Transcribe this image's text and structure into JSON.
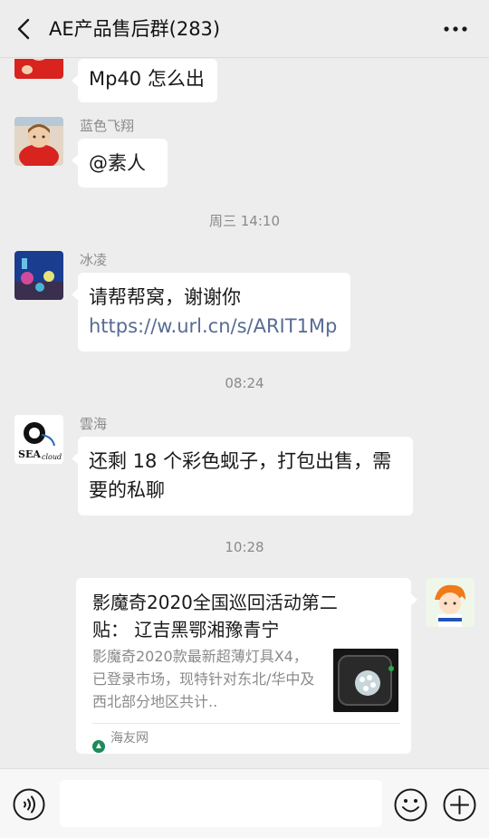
{
  "header": {
    "title": "AE产品售后群(283)",
    "back_icon": "chevron-left-icon",
    "more_icon": "more-dots-icon"
  },
  "messages": [
    {
      "sender": "",
      "text": "Mp40 怎么出"
    },
    {
      "sender": "蓝色飞翔",
      "text": "@素人"
    },
    {
      "timestamp": "周三 14:10"
    },
    {
      "sender": "冰凌",
      "text": "请帮帮窝，谢谢你",
      "link": "https://w.url.cn/s/ARIT1Mp"
    },
    {
      "timestamp": "08:24"
    },
    {
      "sender": "雲海",
      "text": "还剩 18 个彩色蚬子，打包出售，需要的私聊",
      "avatar_text": "sea_cloud"
    },
    {
      "timestamp": "10:28"
    },
    {
      "card": {
        "title": "影魔奇2020全国巡回活动第二贴： 辽吉黑鄂湘豫青宁",
        "desc": "影魔奇2020款最新超薄灯具X4，已登录市场，现特针对东北/华中及西北部分地区共计..",
        "source": "海友网"
      }
    }
  ],
  "composer": {
    "input_value": "",
    "voice_icon": "voice-icon",
    "emoji_icon": "emoji-icon",
    "plus_icon": "plus-icon"
  },
  "colors": {
    "background": "#ededed",
    "bubble": "#ffffff",
    "link": "#576b95",
    "muted_text": "#8a8a8a"
  }
}
